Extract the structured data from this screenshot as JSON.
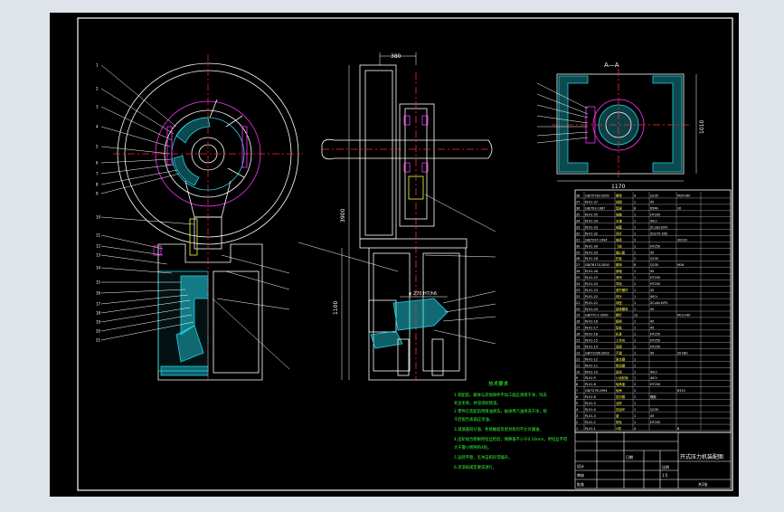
{
  "app": {
    "title": "AutoCAD drawing viewer"
  },
  "colors": {
    "window_bg": "#dfe3ea",
    "sheet_bg": "#000000",
    "frame": "#ffffff",
    "cyan": "#22d3e6",
    "red": "#ff2b2b",
    "magenta": "#ff33ff",
    "yellow": "#ffff33",
    "green": "#33ff33",
    "white": "#ffffff"
  },
  "views": {
    "section_label": "A—A",
    "dim_1170": "1170",
    "dim_1010": "1010",
    "dim_380": "380",
    "dim_3900": "3900",
    "dim_1100": "1100",
    "dim_phi": "φ 270 H7/h6"
  },
  "notes": {
    "title": "技术要求",
    "lines": [
      "1.装配前，箱体与其他铸件不加工面应清理干净，除去",
      "  毛边毛刺，并浸涂防锈漆。",
      "2.零件在装配前用煤油清洗，轴承用汽油清洗干净，晾",
      "  干后配合表面应涂油。",
      "3.减速器剖分面、各接触面及密封处均不允许漏油。",
      "4.齿轮啮合侧隙用铅丝检验，侧隙值不小于0.16mm，用铅丝不得",
      "  大于最小侧隙的4倍。",
      "5.运转平稳，无冲击和异常噪声。",
      "6.涂漆按规定要求进行。"
    ]
  },
  "parts_table": {
    "header": [
      "序号",
      "代号",
      "名称",
      "数量",
      "材料",
      "备注"
    ],
    "rows": [
      [
        "38",
        "GB/T5783-2000",
        "螺栓",
        "4",
        "Q235",
        "M20×60"
      ],
      [
        "37",
        "PJ-01-37",
        "挡圈",
        "1",
        "45",
        ""
      ],
      [
        "36",
        "GB/T93-1987",
        "垫圈",
        "8",
        "65Mn",
        "20"
      ],
      [
        "35",
        "PJ-01-35",
        "端盖",
        "1",
        "HT200",
        ""
      ],
      [
        "34",
        "PJ-01-34",
        "主轴",
        "1",
        "40Cr",
        ""
      ],
      [
        "33",
        "PJ-01-33",
        "轴套",
        "1",
        "ZCuSn10P1",
        ""
      ],
      [
        "32",
        "PJ-01-32",
        "连杆",
        "1",
        "ZG270-500",
        ""
      ],
      [
        "31",
        "GB/T297-1994",
        "轴承",
        "2",
        "",
        "30220"
      ],
      [
        "30",
        "PJ-01-30",
        "飞轮",
        "1",
        "HT250",
        ""
      ],
      [
        "29",
        "PJ-01-29",
        "偏心套",
        "1",
        "45",
        ""
      ],
      [
        "28",
        "PJ-01-28",
        "压板",
        "2",
        "Q235",
        ""
      ],
      [
        "27",
        "GB/T6170-2000",
        "螺母",
        "8",
        "Q235",
        "M16"
      ],
      [
        "26",
        "PJ-01-26",
        "销轴",
        "1",
        "45",
        ""
      ],
      [
        "25",
        "PJ-01-25",
        "滑块",
        "1",
        "HT250",
        ""
      ],
      [
        "24",
        "PJ-01-24",
        "导轨",
        "2",
        "HT200",
        ""
      ],
      [
        "23",
        "PJ-01-23",
        "调节螺杆",
        "1",
        "45",
        ""
      ],
      [
        "22",
        "PJ-01-22",
        "球头",
        "1",
        "40Cr",
        ""
      ],
      [
        "21",
        "PJ-01-21",
        "球座",
        "1",
        "ZCuSn10P1",
        ""
      ],
      [
        "20",
        "PJ-01-20",
        "锁紧螺母",
        "1",
        "45",
        ""
      ],
      [
        "19",
        "GB/T70.1-2000",
        "螺钉",
        "12",
        "",
        "M12×40"
      ],
      [
        "18",
        "PJ-01-18",
        "模柄",
        "1",
        "45",
        ""
      ],
      [
        "17",
        "PJ-01-17",
        "垫板",
        "1",
        "45",
        ""
      ],
      [
        "16",
        "PJ-01-16",
        "机身",
        "1",
        "HT250",
        ""
      ],
      [
        "15",
        "PJ-01-15",
        "工作台",
        "1",
        "HT250",
        ""
      ],
      [
        "14",
        "PJ-01-14",
        "底座",
        "1",
        "HT200",
        ""
      ],
      [
        "13",
        "GB/T1096-2003",
        "平键",
        "1",
        "45",
        "20×80"
      ],
      [
        "12",
        "PJ-01-12",
        "离合器",
        "1",
        "",
        ""
      ],
      [
        "11",
        "PJ-01-11",
        "制动器",
        "1",
        "",
        ""
      ],
      [
        "10",
        "PJ-01-10",
        "齿轮",
        "1",
        "40Cr",
        ""
      ],
      [
        "9",
        "PJ-01-9",
        "小齿轮轴",
        "1",
        "40Cr",
        ""
      ],
      [
        "8",
        "PJ-01-8",
        "轴承盖",
        "2",
        "HT200",
        ""
      ],
      [
        "7",
        "GB/T276-1994",
        "轴承",
        "2",
        "",
        "6315"
      ],
      [
        "6",
        "PJ-01-6",
        "密封圈",
        "2",
        "橡胶",
        ""
      ],
      [
        "5",
        "PJ-01-5",
        "油杯",
        "1",
        "",
        ""
      ],
      [
        "4",
        "PJ-01-4",
        "挡油环",
        "1",
        "Q235",
        ""
      ],
      [
        "3",
        "PJ-01-3",
        "键",
        "1",
        "45",
        ""
      ],
      [
        "2",
        "PJ-01-2",
        "带轮",
        "1",
        "HT200",
        ""
      ],
      [
        "1",
        "PJ-01-1",
        "V带",
        "4",
        "",
        "B"
      ]
    ]
  },
  "title_block": {
    "drawing_name": "开式压力机装配图",
    "scale_label": "比例",
    "scale": "1:5",
    "sheet": "共1张",
    "designer": "设计",
    "checker": "审核",
    "approve": "批准",
    "date": "日期"
  }
}
